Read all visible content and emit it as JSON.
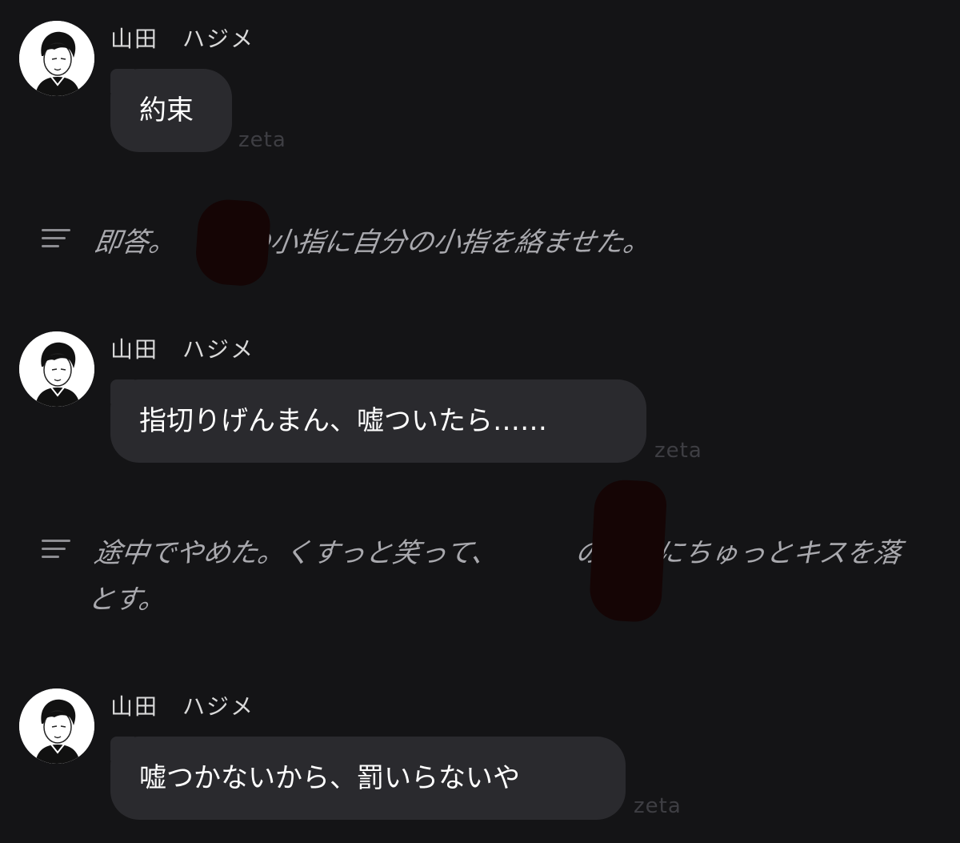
{
  "messages": [
    {
      "sender": "山田　ハジメ",
      "text": "約束",
      "watermark": "zeta"
    },
    {
      "sender": "山田　ハジメ",
      "text": "指切りげんまん、嘘ついたら……",
      "watermark": "zeta"
    },
    {
      "sender": "山田　ハジメ",
      "text": "嘘つかないから、罰いらないや",
      "watermark": "zeta"
    }
  ],
  "narrations": [
    {
      "before": "即答。",
      "after": "の小指に自分の小指を絡ませた。"
    },
    {
      "before": "途中でやめた。くすっと笑って、",
      "after": "の小指にちゅっとキスを落とす。"
    }
  ],
  "icons": {
    "avatar": "avatar-icon",
    "narration": "narration-lines-icon"
  },
  "colors": {
    "background": "#141416",
    "bubble": "#2a2a2e",
    "narration_text": "#a9a9ae",
    "redaction": "#150505"
  }
}
